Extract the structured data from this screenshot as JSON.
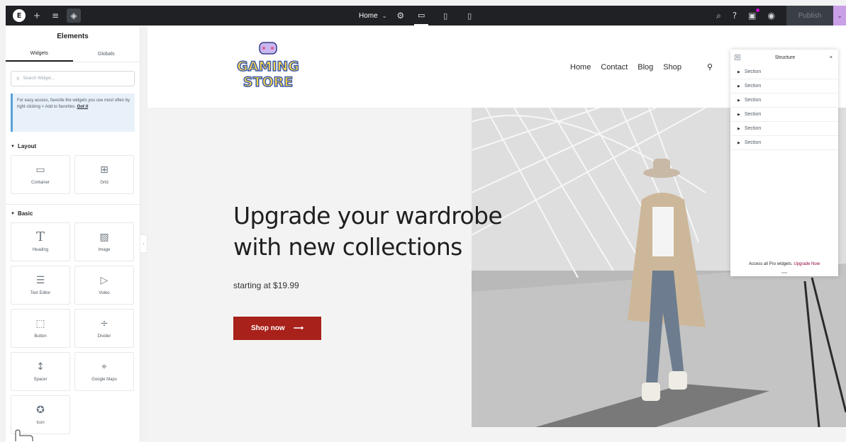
{
  "topbar": {
    "logo": "E",
    "page_selector": "Home",
    "publish": "Publish",
    "icons": [
      "elementor-logo-icon",
      "add-icon",
      "structure-icon",
      "site-settings-icon",
      "page-settings-icon",
      "desktop-icon",
      "tablet-icon",
      "mobile-icon",
      "search-icon",
      "help-icon",
      "whats-new-icon",
      "preview-icon"
    ]
  },
  "panel": {
    "title": "Elements",
    "tabs": [
      "Widgets",
      "Globals"
    ],
    "search_placeholder": "Search Widget...",
    "tip": "For easy access, favorite the widgets you use most often by right clicking > Add to favorites.",
    "tip_link": "Got it",
    "categories": {
      "layout": {
        "label": "Layout",
        "items": [
          {
            "label": "Container",
            "icon": "container-icon"
          },
          {
            "label": "Grid",
            "icon": "grid-icon"
          }
        ]
      },
      "basic": {
        "label": "Basic",
        "items": [
          {
            "label": "Heading",
            "icon": "heading-icon"
          },
          {
            "label": "Image",
            "icon": "image-icon"
          },
          {
            "label": "Text Editor",
            "icon": "text-editor-icon"
          },
          {
            "label": "Video",
            "icon": "video-icon"
          },
          {
            "label": "Button",
            "icon": "button-icon"
          },
          {
            "label": "Divider",
            "icon": "divider-icon"
          },
          {
            "label": "Spacer",
            "icon": "spacer-icon"
          },
          {
            "label": "Google Maps",
            "icon": "google-maps-icon"
          },
          {
            "label": "Icon",
            "icon": "star-icon"
          }
        ]
      }
    }
  },
  "site": {
    "logo_text": [
      "GAMING",
      "STORE"
    ],
    "nav": [
      "Home",
      "Contact",
      "Blog",
      "Shop"
    ],
    "hero": {
      "title_line1": "Upgrade your wardrobe",
      "title_line2": "with new collections",
      "subtitle": "starting at $19.99",
      "cta": "Shop now",
      "cta_arrow": "⟶"
    }
  },
  "structure": {
    "title": "Structure",
    "items": [
      "Section",
      "Section",
      "Section",
      "Section",
      "Section",
      "Section"
    ],
    "footer_text": "Access all Pro widgets.",
    "footer_link": "Upgrade Now"
  },
  "colors": {
    "topbar": "#1f2124",
    "cta": "#a8211a",
    "upgrade_link": "#93003f",
    "publish_caret": "#c9a0e6"
  }
}
